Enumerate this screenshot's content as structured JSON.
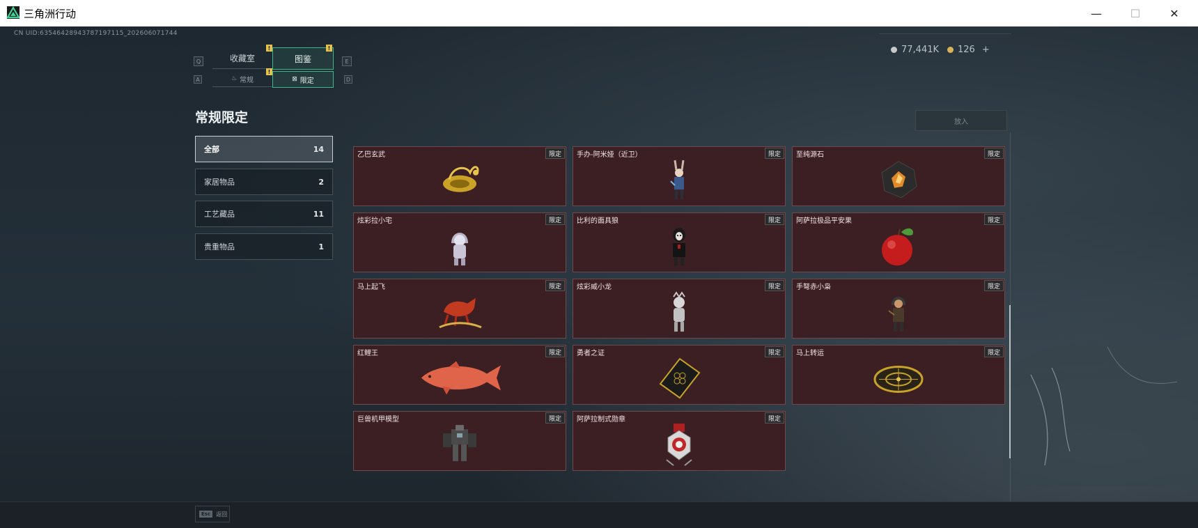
{
  "window": {
    "title": "三角洲行动",
    "minimize": "—",
    "maximize": "☐",
    "close": "✕"
  },
  "header": {
    "uid": "CN UID:6354642894378719711​5_202606071744",
    "currency_coins": "77,441K",
    "currency_tickets": "126",
    "add": "+"
  },
  "tabs": [
    {
      "key": "Q",
      "label": "收藏室",
      "badge": "!"
    },
    {
      "key": "E",
      "label": "图鉴",
      "badge": "!"
    }
  ],
  "subtabs": [
    {
      "key": "A",
      "label": "常规",
      "badge": "!"
    },
    {
      "key": "D",
      "label": "限定"
    }
  ],
  "page_title": "常规限定",
  "categories": [
    {
      "label": "全部",
      "count": "14"
    },
    {
      "label": "家居物品",
      "count": "2"
    },
    {
      "label": "工艺藏品",
      "count": "11"
    },
    {
      "label": "贵重物品",
      "count": "1"
    }
  ],
  "put_in_button": "放入",
  "tag_label": "限定",
  "items": [
    {
      "name": "乙巴玄武",
      "icon": "golden-turtle-icon"
    },
    {
      "name": "手办-阿米娅（近卫）",
      "icon": "bunny-figure-icon"
    },
    {
      "name": "至纯源石",
      "icon": "originium-icon"
    },
    {
      "name": "炫彩拉小宅",
      "icon": "hooded-doll-icon"
    },
    {
      "name": "比利的面具狼",
      "icon": "masked-figure-icon"
    },
    {
      "name": "阿萨拉极品平安果",
      "icon": "apple-icon"
    },
    {
      "name": "马上起飞",
      "icon": "red-horse-icon"
    },
    {
      "name": "炫彩威小龙",
      "icon": "silver-figure-icon"
    },
    {
      "name": "手弩赤小枭",
      "icon": "hooded-archer-icon"
    },
    {
      "name": "红鲤王",
      "icon": "red-carp-icon"
    },
    {
      "name": "勇者之证",
      "icon": "hero-card-icon"
    },
    {
      "name": "马上转运",
      "icon": "golden-disc-icon"
    },
    {
      "name": "巨兽机甲模型",
      "icon": "mech-model-icon"
    },
    {
      "name": "阿萨拉制式勋章",
      "icon": "medal-icon"
    }
  ],
  "footer": {
    "esc_key": "Esc",
    "esc_label": "返回"
  },
  "colors": {
    "accent": "#3fb889",
    "card_bg": "#3c1f23",
    "badge": "#e5c24a"
  }
}
